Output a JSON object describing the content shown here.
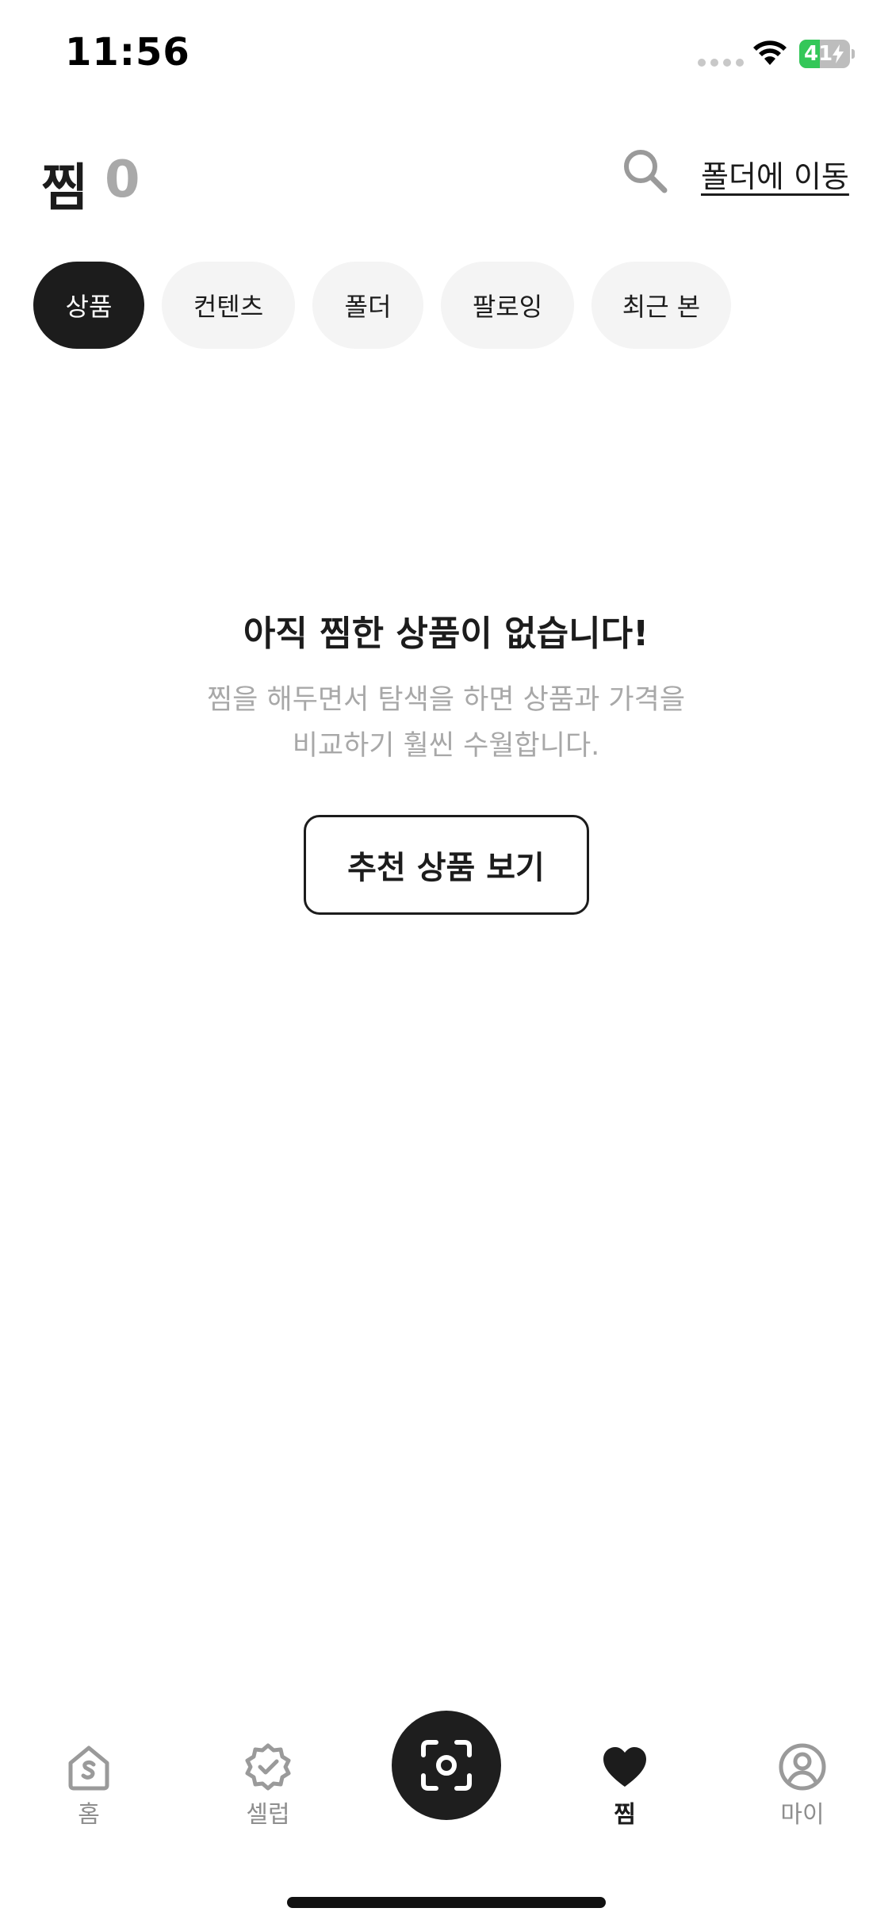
{
  "status_bar": {
    "time": "11:56",
    "battery_level": 41,
    "battery_label": "41",
    "battery_color": "#34c759"
  },
  "header": {
    "title": "찜",
    "count": "0",
    "search_icon": "search-icon",
    "folder_move_label": "폴더에 이동"
  },
  "filter_tabs": [
    {
      "label": "상품",
      "active": true
    },
    {
      "label": "컨텐츠",
      "active": false
    },
    {
      "label": "폴더",
      "active": false
    },
    {
      "label": "팔로잉",
      "active": false
    },
    {
      "label": "최근 본",
      "active": false
    }
  ],
  "empty_state": {
    "title": "아직 찜한 상품이 없습니다!",
    "description_line1": "찜을 해두면서 탐색을 하면 상품과 가격을",
    "description_line2": "비교하기 훨씬 수월합니다.",
    "button_label": "추천 상품 보기"
  },
  "bottom_nav": {
    "items": [
      {
        "label": "홈",
        "icon": "home-icon",
        "active": false
      },
      {
        "label": "셀럽",
        "icon": "verified-badge-icon",
        "active": false
      },
      {
        "label": "",
        "icon": "camera-scan-icon",
        "active": false
      },
      {
        "label": "찜",
        "icon": "heart-icon",
        "active": true
      },
      {
        "label": "마이",
        "icon": "user-icon",
        "active": false
      }
    ]
  },
  "colors": {
    "accent": "#1c1c1c",
    "muted_text": "#a8a8a8",
    "chip_bg": "#f4f4f4"
  }
}
